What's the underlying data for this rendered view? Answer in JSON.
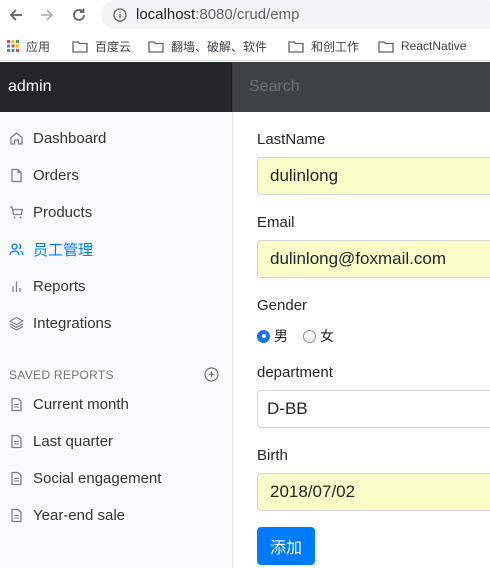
{
  "browser": {
    "url_host": "localhost",
    "url_path": ":8080/crud/emp",
    "bookmarks": [
      {
        "label": "应用",
        "icon": "apps-grid-icon"
      },
      {
        "label": "百度云",
        "icon": "folder-icon"
      },
      {
        "label": "翻墙、破解、软件",
        "icon": "folder-icon"
      },
      {
        "label": "和创工作",
        "icon": "folder-icon"
      },
      {
        "label": "ReactNative",
        "icon": "folder-icon"
      }
    ]
  },
  "navbar": {
    "brand": "admin",
    "search_placeholder": "Search"
  },
  "sidebar": {
    "items": [
      {
        "label": "Dashboard",
        "icon": "home-icon",
        "active": false
      },
      {
        "label": "Orders",
        "icon": "file-icon",
        "active": false
      },
      {
        "label": "Products",
        "icon": "cart-icon",
        "active": false
      },
      {
        "label": "员工管理",
        "icon": "users-icon",
        "active": true
      },
      {
        "label": "Reports",
        "icon": "bar-chart-icon",
        "active": false
      },
      {
        "label": "Integrations",
        "icon": "layers-icon",
        "active": false
      }
    ],
    "saved_reports_heading": "SAVED REPORTS",
    "saved_reports": [
      {
        "label": "Current month",
        "icon": "file-text-icon"
      },
      {
        "label": "Last quarter",
        "icon": "file-text-icon"
      },
      {
        "label": "Social engagement",
        "icon": "file-text-icon"
      },
      {
        "label": "Year-end sale",
        "icon": "file-text-icon"
      }
    ]
  },
  "form": {
    "lastname_label": "LastName",
    "lastname_value": "dulinlong",
    "email_label": "Email",
    "email_value": "dulinlong@foxmail.com",
    "gender_label": "Gender",
    "gender_options": [
      "男",
      "女"
    ],
    "gender_selected": "男",
    "department_label": "department",
    "department_value": "D-BB",
    "birth_label": "Birth",
    "birth_value": "2018/07/02",
    "submit_label": "添加"
  },
  "colors": {
    "primary": "#007bff",
    "navbar": "#343a40",
    "autofill": "#f9fec8"
  }
}
